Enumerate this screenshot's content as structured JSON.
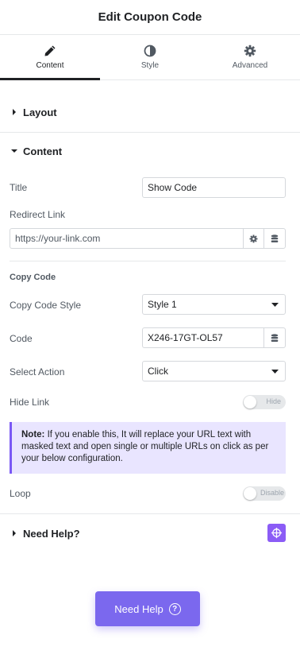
{
  "header": {
    "title": "Edit Coupon Code"
  },
  "tabs": [
    {
      "label": "Content",
      "icon": "pencil-icon",
      "active": true
    },
    {
      "label": "Style",
      "icon": "contrast-icon",
      "active": false
    },
    {
      "label": "Advanced",
      "icon": "gear-icon",
      "active": false
    }
  ],
  "sections": {
    "layout": "Layout",
    "content": "Content",
    "need_help": "Need Help?"
  },
  "fields": {
    "title_label": "Title",
    "title_value": "Show Code",
    "redirect_label": "Redirect Link",
    "redirect_placeholder": "https://your-link.com",
    "copy_code_heading": "Copy Code",
    "copy_style_label": "Copy Code Style",
    "copy_style_value": "Style 1",
    "code_label": "Code",
    "code_value": "X246-17GT-OL57",
    "action_label": "Select Action",
    "action_value": "Click",
    "hide_link_label": "Hide Link",
    "hide_link_toggle": "Hide",
    "loop_label": "Loop",
    "loop_toggle": "Disable"
  },
  "note": {
    "prefix": "Note:",
    "text": "If you enable this, It will replace your URL text with masked text and open single or multiple URLs on click as per your below configuration."
  },
  "help_button": {
    "label": "Need Help",
    "icon": "question-circle-icon"
  },
  "colors": {
    "accent": "#7b68ee",
    "note_bg": "#e9e5ff",
    "note_border": "#7a58f5"
  }
}
